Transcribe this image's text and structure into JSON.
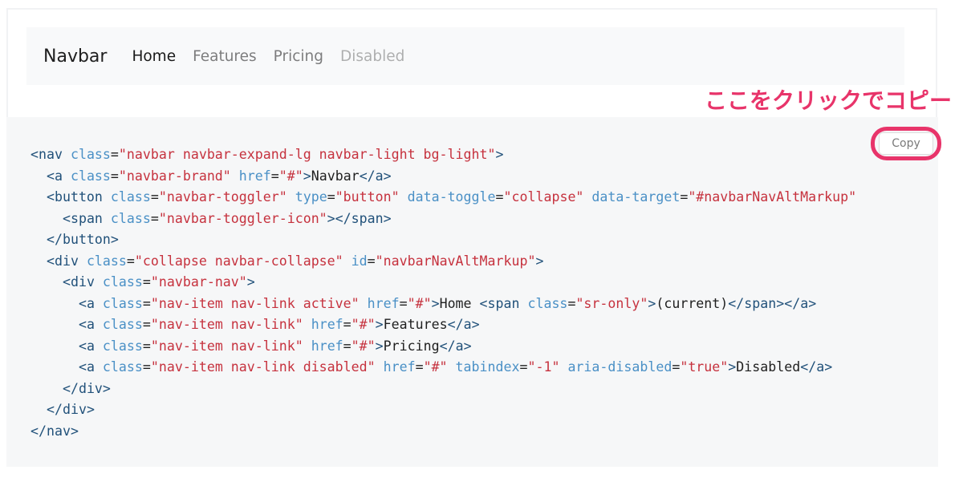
{
  "navbar": {
    "brand": "Navbar",
    "links": [
      {
        "label": "Home",
        "state": "active"
      },
      {
        "label": "Features",
        "state": "normal"
      },
      {
        "label": "Pricing",
        "state": "normal"
      },
      {
        "label": "Disabled",
        "state": "disabled"
      }
    ]
  },
  "copy_button": {
    "label": "Copy"
  },
  "annotation": {
    "text": "ここをクリックでコピー",
    "color": "#e8346a"
  },
  "code": {
    "lines": [
      "<nav class=\"navbar navbar-expand-lg navbar-light bg-light\">",
      "  <a class=\"navbar-brand\" href=\"#\">Navbar</a>",
      "  <button class=\"navbar-toggler\" type=\"button\" data-toggle=\"collapse\" data-target=\"#navbarNavAltMarkup\"",
      "    <span class=\"navbar-toggler-icon\"></span>",
      "  </button>",
      "  <div class=\"collapse navbar-collapse\" id=\"navbarNavAltMarkup\">",
      "    <div class=\"navbar-nav\">",
      "      <a class=\"nav-item nav-link active\" href=\"#\">Home <span class=\"sr-only\">(current)</span></a>",
      "      <a class=\"nav-item nav-link\" href=\"#\">Features</a>",
      "      <a class=\"nav-item nav-link\" href=\"#\">Pricing</a>",
      "      <a class=\"nav-item nav-link disabled\" href=\"#\" tabindex=\"-1\" aria-disabled=\"true\">Disabled</a>",
      "    </div>",
      "  </div>",
      "</nav>"
    ]
  }
}
